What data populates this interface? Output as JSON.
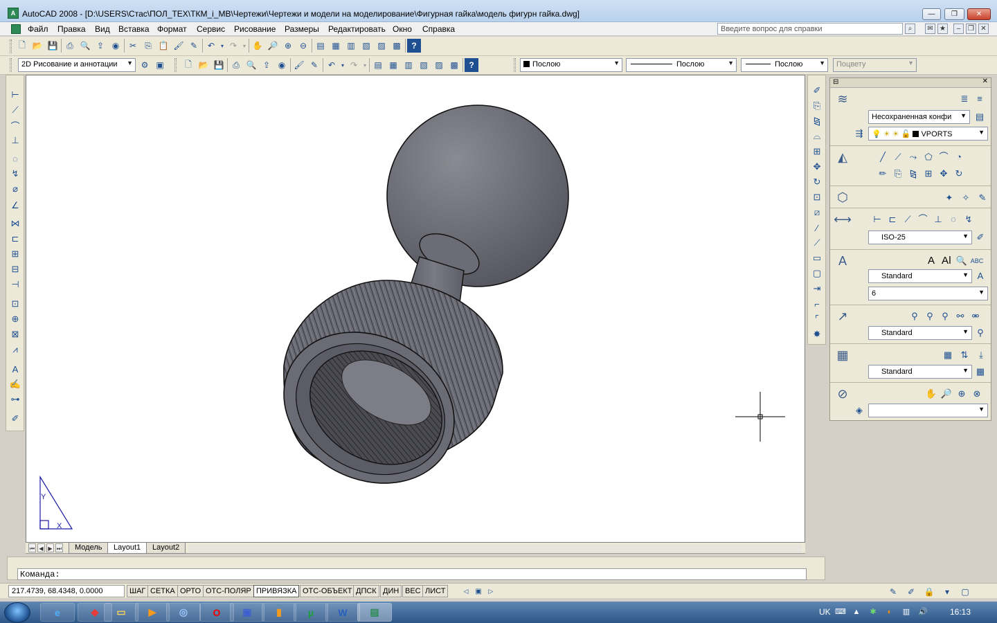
{
  "window": {
    "title": "AutoCAD 2008 - [D:\\USERS\\Стас\\ПОЛ_ТЕХ\\ТКМ_i_MB\\Чертежи\\Чертежи и модели на моделирование\\Фигурная гайка\\модель фигурн гайка.dwg]",
    "app_icon_text": "A"
  },
  "menu": {
    "items": [
      "Файл",
      "Правка",
      "Вид",
      "Вставка",
      "Формат",
      "Сервис",
      "Рисование",
      "Размеры",
      "Редактировать",
      "Окно",
      "Справка"
    ],
    "help_placeholder": "Введите вопрос для справки"
  },
  "toolbar": {
    "workspace": "2D Рисование и аннотации",
    "layer_color": "Послою",
    "linetype": "Послою",
    "lineweight": "Послою",
    "plotstyle": "Поцвету"
  },
  "drawing": {
    "ucs_y": "Y",
    "ucs_x": "X"
  },
  "layout_tabs": [
    "Модель",
    "Layout1",
    "Layout2"
  ],
  "active_tab": "Layout1",
  "command": {
    "prompt": "Команда:"
  },
  "status": {
    "coords": "217.4739, 68.4348, 0.0000",
    "buttons": [
      "ШАГ",
      "СЕТКА",
      "ОРТО",
      "ОТС-ПОЛЯР",
      "ПРИВЯЗКА",
      "ОТС-ОБЪЕКТ",
      "ДПСК",
      "ДИН",
      "ВЕС",
      "ЛИСТ"
    ],
    "active_buttons": [
      "ПРИВЯЗКА"
    ]
  },
  "palette": {
    "layer_state": "Несохраненная конфи",
    "current_layer": "VPORTS",
    "dim_style": "ISO-25",
    "text_style": "Standard",
    "text_height": "6",
    "mleader_style": "Standard",
    "table_style": "Standard",
    "table_style_2": "Standard"
  },
  "taskbar": {
    "language": "UK",
    "time": "16:13"
  },
  "colors": {
    "titlebar": "#b9d1ec",
    "toolbar": "#ece9d8",
    "model_shade": "#6e6e78",
    "ucs": "#1a1aa8"
  }
}
